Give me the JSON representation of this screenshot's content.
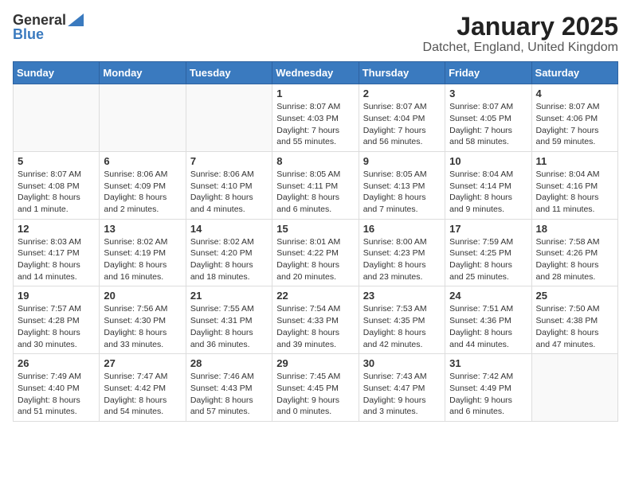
{
  "header": {
    "logo_general": "General",
    "logo_blue": "Blue",
    "title": "January 2025",
    "location": "Datchet, England, United Kingdom"
  },
  "weekdays": [
    "Sunday",
    "Monday",
    "Tuesday",
    "Wednesday",
    "Thursday",
    "Friday",
    "Saturday"
  ],
  "weeks": [
    [
      {
        "day": "",
        "info": ""
      },
      {
        "day": "",
        "info": ""
      },
      {
        "day": "",
        "info": ""
      },
      {
        "day": "1",
        "info": "Sunrise: 8:07 AM\nSunset: 4:03 PM\nDaylight: 7 hours and 55 minutes."
      },
      {
        "day": "2",
        "info": "Sunrise: 8:07 AM\nSunset: 4:04 PM\nDaylight: 7 hours and 56 minutes."
      },
      {
        "day": "3",
        "info": "Sunrise: 8:07 AM\nSunset: 4:05 PM\nDaylight: 7 hours and 58 minutes."
      },
      {
        "day": "4",
        "info": "Sunrise: 8:07 AM\nSunset: 4:06 PM\nDaylight: 7 hours and 59 minutes."
      }
    ],
    [
      {
        "day": "5",
        "info": "Sunrise: 8:07 AM\nSunset: 4:08 PM\nDaylight: 8 hours and 1 minute."
      },
      {
        "day": "6",
        "info": "Sunrise: 8:06 AM\nSunset: 4:09 PM\nDaylight: 8 hours and 2 minutes."
      },
      {
        "day": "7",
        "info": "Sunrise: 8:06 AM\nSunset: 4:10 PM\nDaylight: 8 hours and 4 minutes."
      },
      {
        "day": "8",
        "info": "Sunrise: 8:05 AM\nSunset: 4:11 PM\nDaylight: 8 hours and 6 minutes."
      },
      {
        "day": "9",
        "info": "Sunrise: 8:05 AM\nSunset: 4:13 PM\nDaylight: 8 hours and 7 minutes."
      },
      {
        "day": "10",
        "info": "Sunrise: 8:04 AM\nSunset: 4:14 PM\nDaylight: 8 hours and 9 minutes."
      },
      {
        "day": "11",
        "info": "Sunrise: 8:04 AM\nSunset: 4:16 PM\nDaylight: 8 hours and 11 minutes."
      }
    ],
    [
      {
        "day": "12",
        "info": "Sunrise: 8:03 AM\nSunset: 4:17 PM\nDaylight: 8 hours and 14 minutes."
      },
      {
        "day": "13",
        "info": "Sunrise: 8:02 AM\nSunset: 4:19 PM\nDaylight: 8 hours and 16 minutes."
      },
      {
        "day": "14",
        "info": "Sunrise: 8:02 AM\nSunset: 4:20 PM\nDaylight: 8 hours and 18 minutes."
      },
      {
        "day": "15",
        "info": "Sunrise: 8:01 AM\nSunset: 4:22 PM\nDaylight: 8 hours and 20 minutes."
      },
      {
        "day": "16",
        "info": "Sunrise: 8:00 AM\nSunset: 4:23 PM\nDaylight: 8 hours and 23 minutes."
      },
      {
        "day": "17",
        "info": "Sunrise: 7:59 AM\nSunset: 4:25 PM\nDaylight: 8 hours and 25 minutes."
      },
      {
        "day": "18",
        "info": "Sunrise: 7:58 AM\nSunset: 4:26 PM\nDaylight: 8 hours and 28 minutes."
      }
    ],
    [
      {
        "day": "19",
        "info": "Sunrise: 7:57 AM\nSunset: 4:28 PM\nDaylight: 8 hours and 30 minutes."
      },
      {
        "day": "20",
        "info": "Sunrise: 7:56 AM\nSunset: 4:30 PM\nDaylight: 8 hours and 33 minutes."
      },
      {
        "day": "21",
        "info": "Sunrise: 7:55 AM\nSunset: 4:31 PM\nDaylight: 8 hours and 36 minutes."
      },
      {
        "day": "22",
        "info": "Sunrise: 7:54 AM\nSunset: 4:33 PM\nDaylight: 8 hours and 39 minutes."
      },
      {
        "day": "23",
        "info": "Sunrise: 7:53 AM\nSunset: 4:35 PM\nDaylight: 8 hours and 42 minutes."
      },
      {
        "day": "24",
        "info": "Sunrise: 7:51 AM\nSunset: 4:36 PM\nDaylight: 8 hours and 44 minutes."
      },
      {
        "day": "25",
        "info": "Sunrise: 7:50 AM\nSunset: 4:38 PM\nDaylight: 8 hours and 47 minutes."
      }
    ],
    [
      {
        "day": "26",
        "info": "Sunrise: 7:49 AM\nSunset: 4:40 PM\nDaylight: 8 hours and 51 minutes."
      },
      {
        "day": "27",
        "info": "Sunrise: 7:47 AM\nSunset: 4:42 PM\nDaylight: 8 hours and 54 minutes."
      },
      {
        "day": "28",
        "info": "Sunrise: 7:46 AM\nSunset: 4:43 PM\nDaylight: 8 hours and 57 minutes."
      },
      {
        "day": "29",
        "info": "Sunrise: 7:45 AM\nSunset: 4:45 PM\nDaylight: 9 hours and 0 minutes."
      },
      {
        "day": "30",
        "info": "Sunrise: 7:43 AM\nSunset: 4:47 PM\nDaylight: 9 hours and 3 minutes."
      },
      {
        "day": "31",
        "info": "Sunrise: 7:42 AM\nSunset: 4:49 PM\nDaylight: 9 hours and 6 minutes."
      },
      {
        "day": "",
        "info": ""
      }
    ]
  ]
}
